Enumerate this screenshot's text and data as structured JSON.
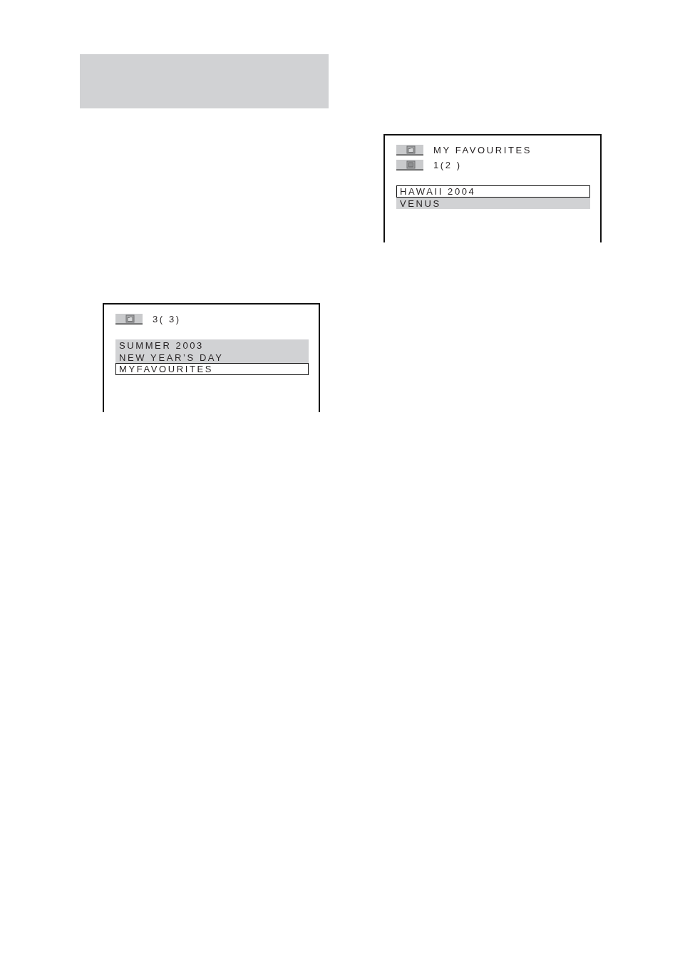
{
  "screens": [
    {
      "header_rows": [
        {
          "kind": "folder",
          "text": "3( 3)"
        }
      ],
      "items": [
        {
          "label": "SUMMER 2003",
          "selected": false
        },
        {
          "label": "NEW YEAR’S DAY",
          "selected": false
        },
        {
          "label": "MYFAVOURITES",
          "selected": true
        }
      ]
    },
    {
      "header_rows": [
        {
          "kind": "folder",
          "text": "MY FAVOURITES"
        },
        {
          "kind": "file",
          "text": "1(2 )"
        }
      ],
      "items": [
        {
          "label": "HAWAII 2004",
          "selected": true
        },
        {
          "label": "VENUS",
          "selected": false
        }
      ]
    }
  ]
}
